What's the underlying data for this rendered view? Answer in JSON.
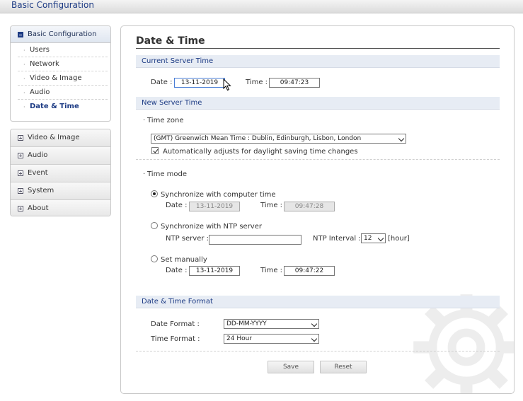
{
  "app": {
    "title": "Basic Configuration"
  },
  "sidebar": {
    "header": "Basic Configuration",
    "items": [
      {
        "label": "Users"
      },
      {
        "label": "Network"
      },
      {
        "label": "Video & Image"
      },
      {
        "label": "Audio"
      },
      {
        "label": "Date & Time",
        "active": true
      }
    ],
    "groups": [
      {
        "label": "Video & Image"
      },
      {
        "label": "Audio"
      },
      {
        "label": "Event"
      },
      {
        "label": "System"
      },
      {
        "label": "About"
      }
    ]
  },
  "main": {
    "title": "Date & Time",
    "current": {
      "section": "Current Server Time",
      "date_label": "Date :",
      "date_value": "13-11-2019",
      "time_label": "Time :",
      "time_value": "09:47:23"
    },
    "new": {
      "section": "New Server Time",
      "timezone_label": "Time zone",
      "timezone_value": "(GMT) Greenwich Mean Time : Dublin, Edinburgh, Lisbon, London",
      "dst_label": "Automatically adjusts for daylight saving time changes",
      "dst_checked": true,
      "timemode_label": "Time mode",
      "sync_computer_label": "Synchronize with computer time",
      "sync_computer_selected": true,
      "sync_date_label": "Date :",
      "sync_date_value": "13-11-2019",
      "sync_time_label": "Time :",
      "sync_time_value": "09:47:28",
      "sync_ntp_label": "Synchronize with NTP server",
      "ntp_server_label": "NTP server :",
      "ntp_server_value": "",
      "ntp_interval_label": "NTP Interval :",
      "ntp_interval_value": "12",
      "ntp_interval_unit": "[hour]",
      "manual_label": "Set manually",
      "manual_date_label": "Date :",
      "manual_date_value": "13-11-2019",
      "manual_time_label": "Time :",
      "manual_time_value": "09:47:22"
    },
    "format": {
      "section": "Date & Time Format",
      "date_format_label": "Date Format :",
      "date_format_value": "DD-MM-YYYY",
      "time_format_label": "Time Format :",
      "time_format_value": "24 Hour"
    },
    "buttons": {
      "save": "Save",
      "reset": "Reset"
    }
  },
  "colors": {
    "accent": "#1d3b84",
    "section_bg": "#e7ecf4"
  }
}
